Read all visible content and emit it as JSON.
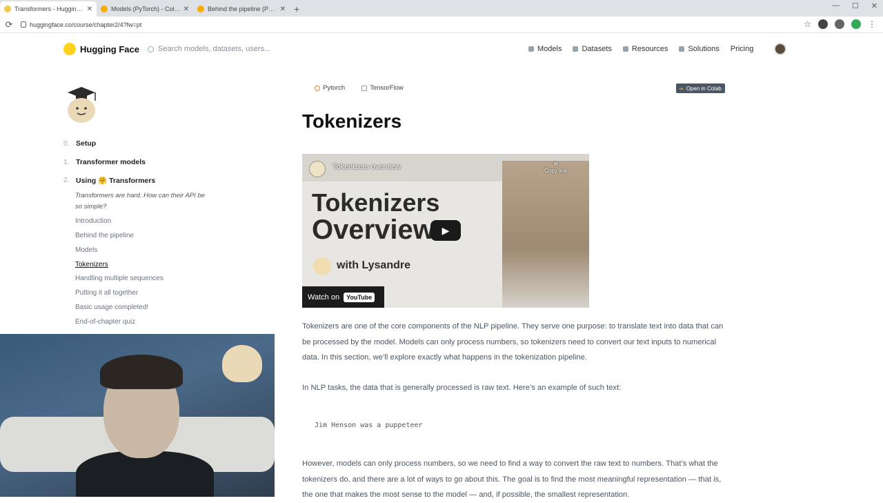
{
  "browser": {
    "tabs": [
      {
        "label": "Transformers - Hugging Face",
        "active": true
      },
      {
        "label": "Models (PyTorch) - Colaboratory",
        "active": false
      },
      {
        "label": "Behind the pipeline (PyTorch) - Colab",
        "active": false
      }
    ],
    "url": "huggingface.co/course/chapter2/4?fw=pt"
  },
  "navbar": {
    "brand": "Hugging Face",
    "search_placeholder": "Search models, datasets, users...",
    "links": [
      "Models",
      "Datasets",
      "Resources",
      "Solutions",
      "Pricing"
    ]
  },
  "sidebar": {
    "chapters": [
      {
        "num": "0.",
        "label": "Setup"
      },
      {
        "num": "1.",
        "label": "Transformer models"
      },
      {
        "num": "2.",
        "label": "Using 🤗 Transformers"
      }
    ],
    "tagline": "Transformers are hard. How can their API be so simple?",
    "sections": [
      "Introduction",
      "Behind the pipeline",
      "Models",
      "Tokenizers",
      "Handling multiple sequences",
      "Putting it all together",
      "Basic usage completed!",
      "End-of-chapter quiz"
    ],
    "active_section": "Tokenizers"
  },
  "main": {
    "framework_tabs": [
      "Pytorch",
      "TensorFlow"
    ],
    "colab_label": "Open in Colab",
    "title": "Tokenizers",
    "video": {
      "channel_title": "Tokenizers overview",
      "copy_link": "Copy link",
      "headline_1": "Tokenizers",
      "headline_2": "Overview",
      "with_text": "with Lysandre",
      "watch_on": "Watch on",
      "youtube": "YouTube"
    },
    "paragraphs": [
      "Tokenizers are one of the core components of the NLP pipeline. They serve one purpose: to translate text into data that can be processed by the model. Models can only process numbers, so tokenizers need to convert our text inputs to numerical data. In this section, we’ll explore exactly what happens in the tokenization pipeline.",
      "In NLP tasks, the data that is generally processed is raw text. Here’s an example of such text:",
      "However, models can only process numbers, so we need to find a way to convert the raw text to numbers. That’s what the tokenizers do, and there are a lot of ways to go about this. The goal is to find the most meaningful representation — that is, the one that makes the most sense to the model — and, if possible, the smallest representation."
    ],
    "code_example": "Jim Henson was a puppeteer"
  }
}
